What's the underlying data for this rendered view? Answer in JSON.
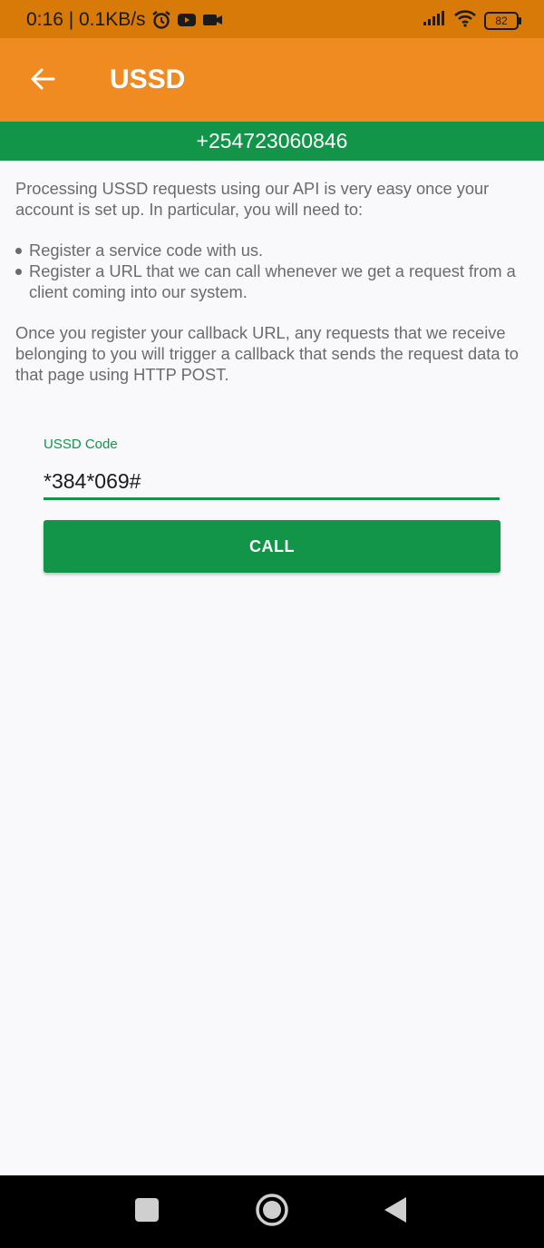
{
  "status_bar": {
    "time_speed": "0:16 | 0.1KB/s",
    "battery": "82",
    "icons": [
      "alarm-icon",
      "youtube-icon",
      "video-camera-icon",
      "signal-icon",
      "wifi-icon",
      "battery-icon"
    ]
  },
  "app_bar": {
    "title": "USSD",
    "back_icon": "arrow-left-icon",
    "background": "#f08b22"
  },
  "phone_banner": {
    "number": "+254723060846",
    "background": "#129449"
  },
  "content": {
    "intro": "Processing USSD requests using our API is very easy once your account is set up. In particular, you will need to:",
    "bullets": [
      "Register a service code with us.",
      "Register a URL that we can call whenever we get a request from a client coming into our system."
    ],
    "outro": "Once you register your callback URL, any requests that we receive belonging to you will trigger a callback that sends the request data to that page using HTTP POST."
  },
  "form": {
    "ussd_label": "USSD Code",
    "ussd_value": "*384*069#",
    "call_label": "CALL",
    "accent": "#129449"
  },
  "nav_bar": {
    "icons": [
      "recents-square-icon",
      "home-circle-icon",
      "back-triangle-icon"
    ]
  }
}
